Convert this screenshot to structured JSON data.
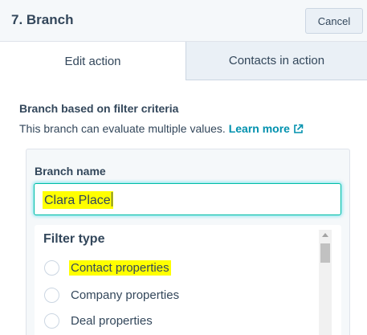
{
  "header": {
    "title": "7. Branch",
    "cancel_label": "Cancel"
  },
  "tabs": [
    {
      "label": "Edit action",
      "active": true
    },
    {
      "label": "Contacts in action",
      "active": false
    }
  ],
  "section": {
    "heading": "Branch based on filter criteria",
    "description": "This branch can evaluate multiple values.",
    "link_label": "Learn more",
    "link_icon": "external-link-icon"
  },
  "branch": {
    "name_label": "Branch name",
    "name_value": "Clara Place"
  },
  "filter": {
    "title": "Filter type",
    "options": [
      {
        "label": "Contact properties",
        "selected": false
      },
      {
        "label": "Company properties",
        "selected": false
      },
      {
        "label": "Deal properties",
        "selected": false
      }
    ]
  },
  "colors": {
    "link": "#0091ae",
    "focus_border": "#00bda5",
    "highlight": "#ffff00",
    "text": "#33475b"
  }
}
